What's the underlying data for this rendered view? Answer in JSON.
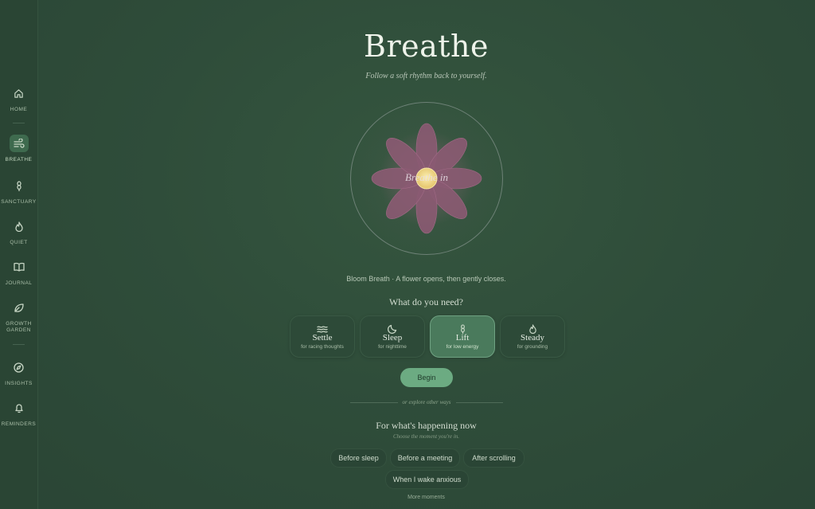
{
  "sidebar": {
    "items": [
      {
        "label": "HOME",
        "icon": "home-icon"
      },
      {
        "label": "BREATHE",
        "icon": "wind-icon",
        "active": true
      },
      {
        "label": "SANCTUARY",
        "icon": "lotus-icon"
      },
      {
        "label": "QUIET",
        "icon": "flame-icon"
      },
      {
        "label": "JOURNAL",
        "icon": "book-icon"
      },
      {
        "label": "GROWTH GARDEN",
        "icon": "leaf-icon"
      },
      {
        "label": "INSIGHTS",
        "icon": "compass-icon"
      },
      {
        "label": "REMINDERS",
        "icon": "bell-icon"
      }
    ]
  },
  "header": {
    "title": "Breathe",
    "subtitle": "Follow a soft rhythm back to yourself."
  },
  "flower": {
    "phase": "Breathe in",
    "caption": "Bloom Breath · A flower opens, then gently closes."
  },
  "need": {
    "question": "What do you need?",
    "options": [
      {
        "name": "Settle",
        "sub": "for racing thoughts",
        "icon": "waves-icon"
      },
      {
        "name": "Sleep",
        "sub": "for nighttime",
        "icon": "moon-icon"
      },
      {
        "name": "Lift",
        "sub": "for low energy",
        "icon": "lotus-icon",
        "active": true
      },
      {
        "name": "Steady",
        "sub": "for grounding",
        "icon": "flame-icon"
      }
    ]
  },
  "begin_label": "Begin",
  "explore_label": "or explore other ways",
  "happening": {
    "title": "For what's happening now",
    "subtitle": "Choose the moment you're in.",
    "chips": [
      "Before sleep",
      "Before a meeting",
      "After scrolling",
      "When I wake anxious"
    ],
    "more": "More moments"
  },
  "colors": {
    "background": "#2f4d3a",
    "accent": "#6cab82",
    "petal": "#8a5a72",
    "center": "#f0d98a"
  }
}
